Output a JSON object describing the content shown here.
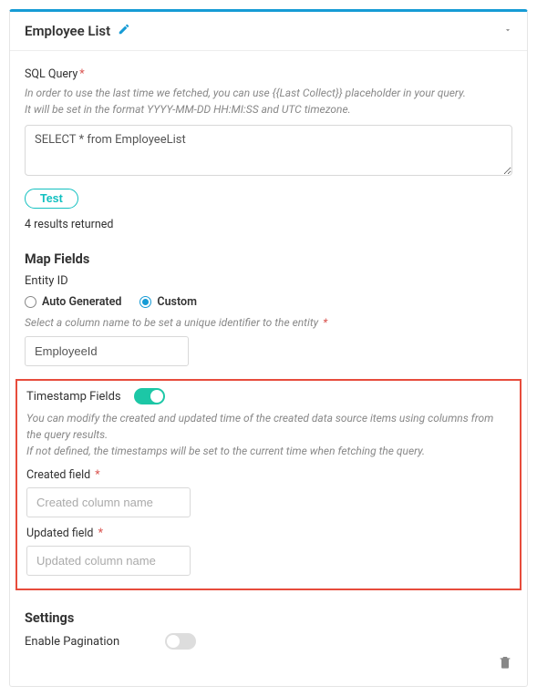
{
  "header": {
    "title": "Employee List"
  },
  "sql": {
    "label": "SQL Query",
    "hint1": "In order to use the last time we fetched, you can use {{Last Collect}} placeholder in your query.",
    "hint2": "It will be set in the format YYYY-MM-DD HH:MI:SS and UTC timezone.",
    "value": "SELECT * from EmployeeList",
    "test_label": "Test",
    "result": "4 results returned"
  },
  "map": {
    "title": "Map Fields",
    "entity_label": "Entity ID",
    "radio_auto": "Auto Generated",
    "radio_custom": "Custom",
    "hint": "Select a column name to be set a unique identifier to the entity",
    "entity_value": "EmployeeId"
  },
  "timestamp": {
    "title": "Timestamp Fields",
    "hint1": "You can modify the created and updated time of the created data source items using columns from the query results.",
    "hint2": "If not defined, the timestamps will be set to the current time when fetching the query.",
    "created_label": "Created field",
    "created_placeholder": "Created column name",
    "updated_label": "Updated field",
    "updated_placeholder": "Updated column name"
  },
  "settings": {
    "title": "Settings",
    "pagination_label": "Enable Pagination"
  }
}
